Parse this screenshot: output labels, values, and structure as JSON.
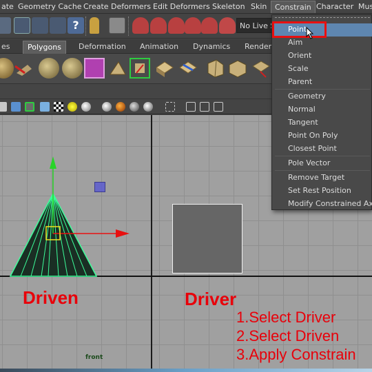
{
  "menubar": {
    "items": [
      "ate",
      "Geometry Cache",
      "Create Deformers",
      "Edit Deformers",
      "Skeleton",
      "Skin",
      "Constrain",
      "Character",
      "Mus"
    ],
    "active": "Constrain"
  },
  "status_line": {
    "live_field": "No Live S"
  },
  "shelf_tabs": {
    "items": [
      "es",
      "Polygons",
      "Deformation",
      "Animation",
      "Dynamics",
      "Renderi"
    ],
    "selected": "Polygons"
  },
  "constrain_menu": {
    "items": [
      {
        "label": "Point",
        "highlighted": true
      },
      {
        "label": "Aim"
      },
      {
        "label": "Orient"
      },
      {
        "label": "Scale"
      },
      {
        "label": "Parent"
      },
      {
        "label": "Geometry"
      },
      {
        "label": "Normal"
      },
      {
        "label": "Tangent"
      },
      {
        "label": "Point On Poly"
      },
      {
        "label": "Closest Point"
      },
      {
        "label": "Pole Vector"
      },
      {
        "label": "Remove Target"
      },
      {
        "label": "Set Rest Position"
      },
      {
        "label": "Modify Constrained Axis..."
      }
    ]
  },
  "viewport": {
    "camera_label": "front",
    "driven_label": "Driven",
    "driver_label": "Driver",
    "steps": [
      "1.Select Driver",
      "2.Select Driven",
      "3.Apply Constrain"
    ]
  },
  "colors": {
    "annotation_red": "#e8000a",
    "menu_highlight": "#5e86b0",
    "wire_green": "#3cff9a",
    "grid": "#a0a0a0"
  },
  "icons": [
    "lasso-icon",
    "select-icon",
    "paint-select-icon",
    "move-icon",
    "help-icon",
    "lock-icon",
    "snap-grid-icon",
    "snap-curve-icon",
    "snap-point-icon",
    "snap-plane-icon",
    "make-live-icon",
    "cone-icon",
    "sphere-icon",
    "cube-icon",
    "render-icon"
  ]
}
